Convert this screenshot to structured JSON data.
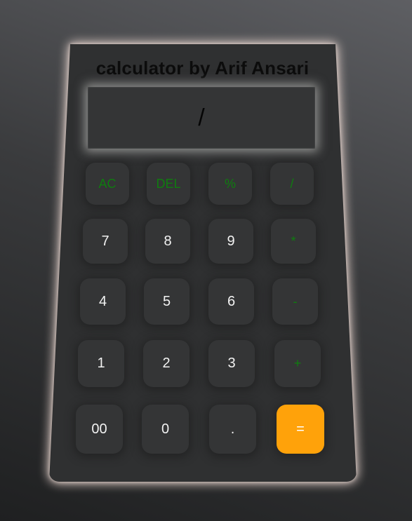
{
  "app": {
    "title": "calculator by Arif Ansari"
  },
  "display": {
    "value": "/"
  },
  "keys": {
    "ac": "AC",
    "del": "DEL",
    "percent": "%",
    "divide": "/",
    "seven": "7",
    "eight": "8",
    "nine": "9",
    "multiply": "*",
    "four": "4",
    "five": "5",
    "six": "6",
    "minus": "-",
    "one": "1",
    "two": "2",
    "three": "3",
    "plus": "+",
    "double_zero": "00",
    "zero": "0",
    "dot": ".",
    "equals": "="
  },
  "colors": {
    "operator_text": "#0f7d0f",
    "equals_button": "#ffa20a",
    "body": "#2f3031"
  }
}
